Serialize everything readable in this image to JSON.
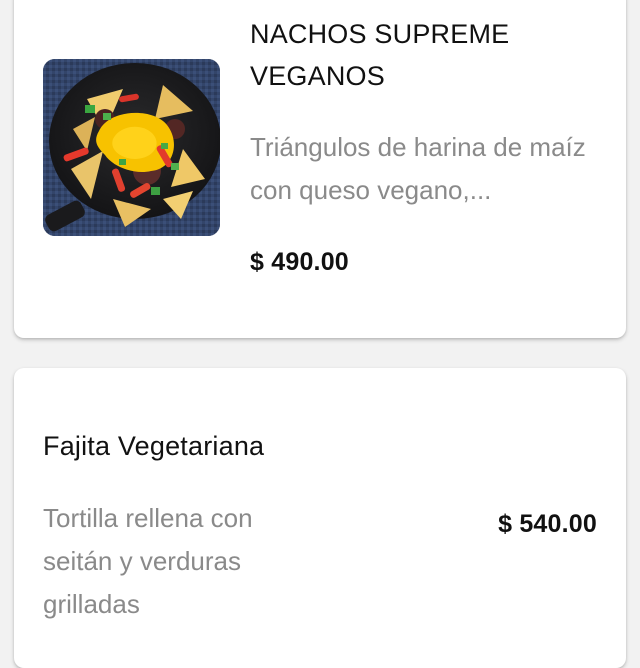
{
  "products": [
    {
      "title": "NACHOS SUPREME VEGANOS",
      "description": "Triángulos de harina de maíz con queso vegano,...",
      "price": "$ 490.00",
      "image_icon": "nachos-photo"
    },
    {
      "title": "Fajita Vegetariana",
      "description": "Tortilla rellena con seitán y verduras grilladas",
      "price": "$ 540.00"
    }
  ],
  "colors": {
    "background": "#f2f2f2",
    "card": "#ffffff",
    "title": "#111111",
    "description": "#8a8a8a",
    "price": "#111111"
  }
}
